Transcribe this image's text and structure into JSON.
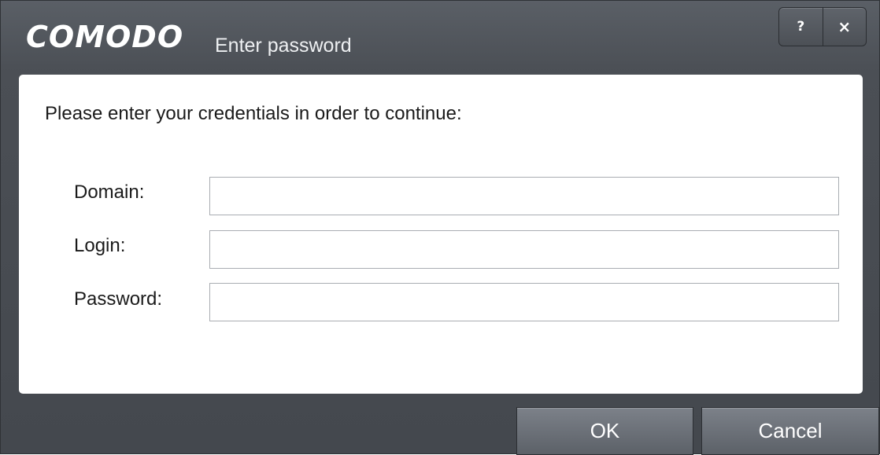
{
  "window": {
    "logo_text": "COMODO",
    "title": "Enter password",
    "help_label": "?",
    "close_label": "×"
  },
  "content": {
    "prompt": "Please enter your credentials in order to continue:",
    "fields": [
      {
        "label": "Domain:",
        "value": "",
        "placeholder": ""
      },
      {
        "label": "Login:",
        "value": "",
        "placeholder": ""
      },
      {
        "label": "Password:",
        "value": "",
        "placeholder": ""
      }
    ]
  },
  "buttons": {
    "ok_label": "OK",
    "cancel_label": "Cancel"
  },
  "colors": {
    "titlebar_bg": "#4b4f55",
    "content_bg": "#ffffff",
    "button_bg": "#6a6f76"
  },
  "icons": {
    "help": "help-icon",
    "close": "close-icon"
  }
}
